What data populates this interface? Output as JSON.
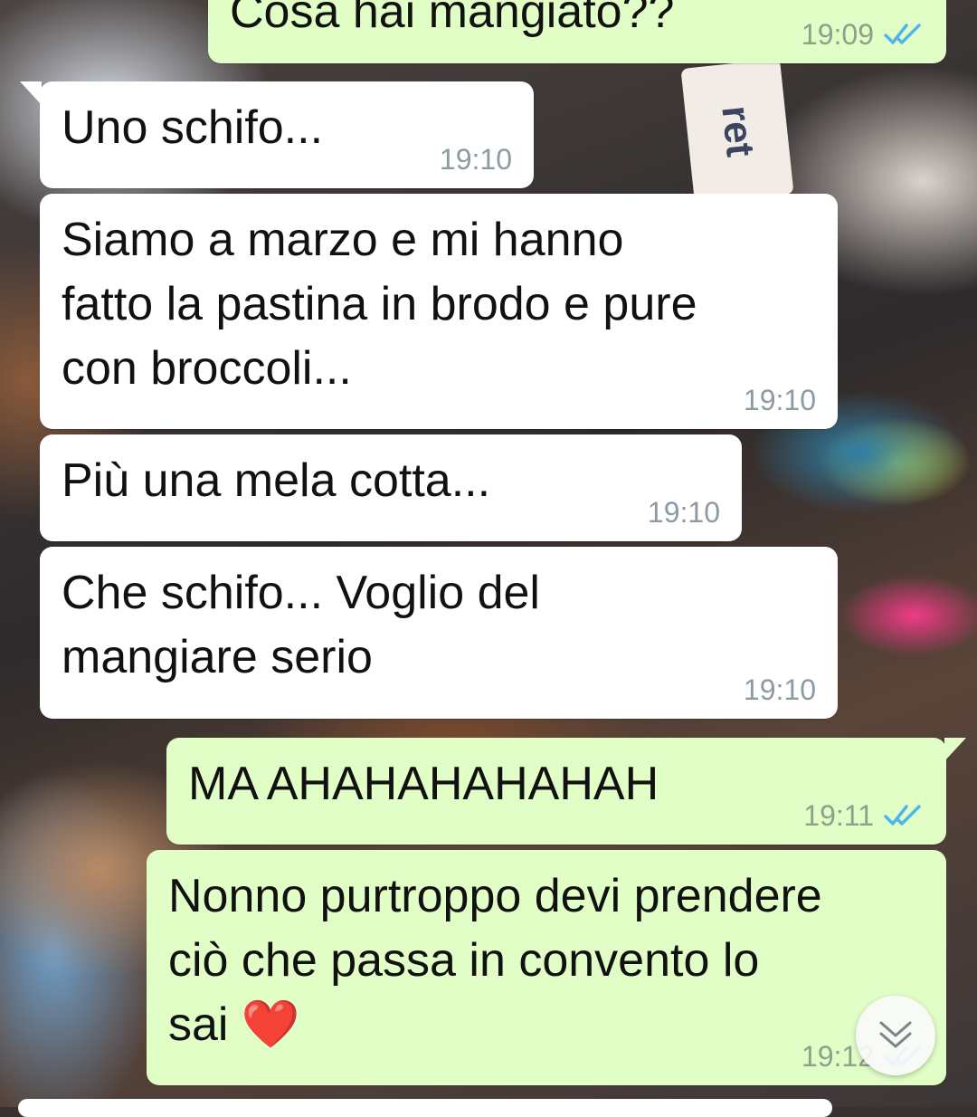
{
  "chat": {
    "messages": [
      {
        "id": "m1",
        "direction": "out",
        "text": "Cosa hai mangiato??",
        "time": "19:09",
        "status": "read"
      },
      {
        "id": "m2",
        "direction": "in",
        "text": "Uno schifo...",
        "time": "19:10"
      },
      {
        "id": "m3",
        "direction": "in",
        "lines": [
          "Siamo a marzo e mi hanno",
          "fatto la pastina in brodo e pure",
          "con broccoli..."
        ],
        "time": "19:10"
      },
      {
        "id": "m4",
        "direction": "in",
        "text": "Più una mela cotta...",
        "time": "19:10"
      },
      {
        "id": "m5",
        "direction": "in",
        "lines": [
          "Che schifo... Voglio del",
          "mangiare serio"
        ],
        "time": "19:10"
      },
      {
        "id": "m6",
        "direction": "out",
        "text": "MA AHAHAHAHAHAH",
        "time": "19:11",
        "status": "read"
      },
      {
        "id": "m7",
        "direction": "out",
        "lines": [
          "Nonno purtroppo devi prendere",
          "ciò che passa in convento lo",
          "sai ❤️"
        ],
        "time": "19:12",
        "status": "read"
      }
    ]
  },
  "wallpaper": {
    "tag_text": "ret"
  },
  "colors": {
    "incoming_bubble": "#ffffff",
    "outgoing_bubble": "#e1fec6",
    "read_tick": "#4fb6ec",
    "timestamp": "#8c9aa2"
  },
  "icons": {
    "read_receipt": "double-check-icon",
    "scroll_down": "double-chevron-down-icon"
  }
}
